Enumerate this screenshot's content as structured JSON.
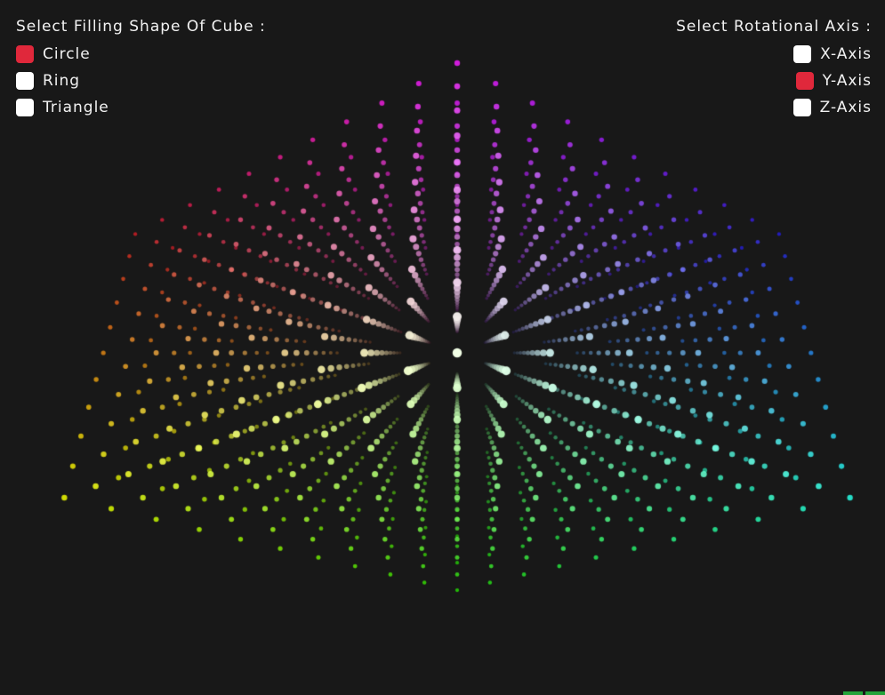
{
  "colors": {
    "background": "#181818",
    "accent": "#e0283b",
    "text": "#f2f2f2",
    "unselected": "#ffffff"
  },
  "shape_panel": {
    "title": "Select Filling Shape Of Cube :",
    "options": [
      {
        "label": "Circle",
        "selected": true
      },
      {
        "label": "Ring",
        "selected": false
      },
      {
        "label": "Triangle",
        "selected": false
      }
    ]
  },
  "axis_panel": {
    "title": "Select Rotational Axis :",
    "options": [
      {
        "label": "X-Axis",
        "selected": false
      },
      {
        "label": "Y-Axis",
        "selected": true
      },
      {
        "label": "Z-Axis",
        "selected": false
      }
    ]
  },
  "visualization": {
    "subject": "point-cloud-cube",
    "fill_shape": "circle",
    "rotation_axis": "Y",
    "grid_divisions": 10
  }
}
